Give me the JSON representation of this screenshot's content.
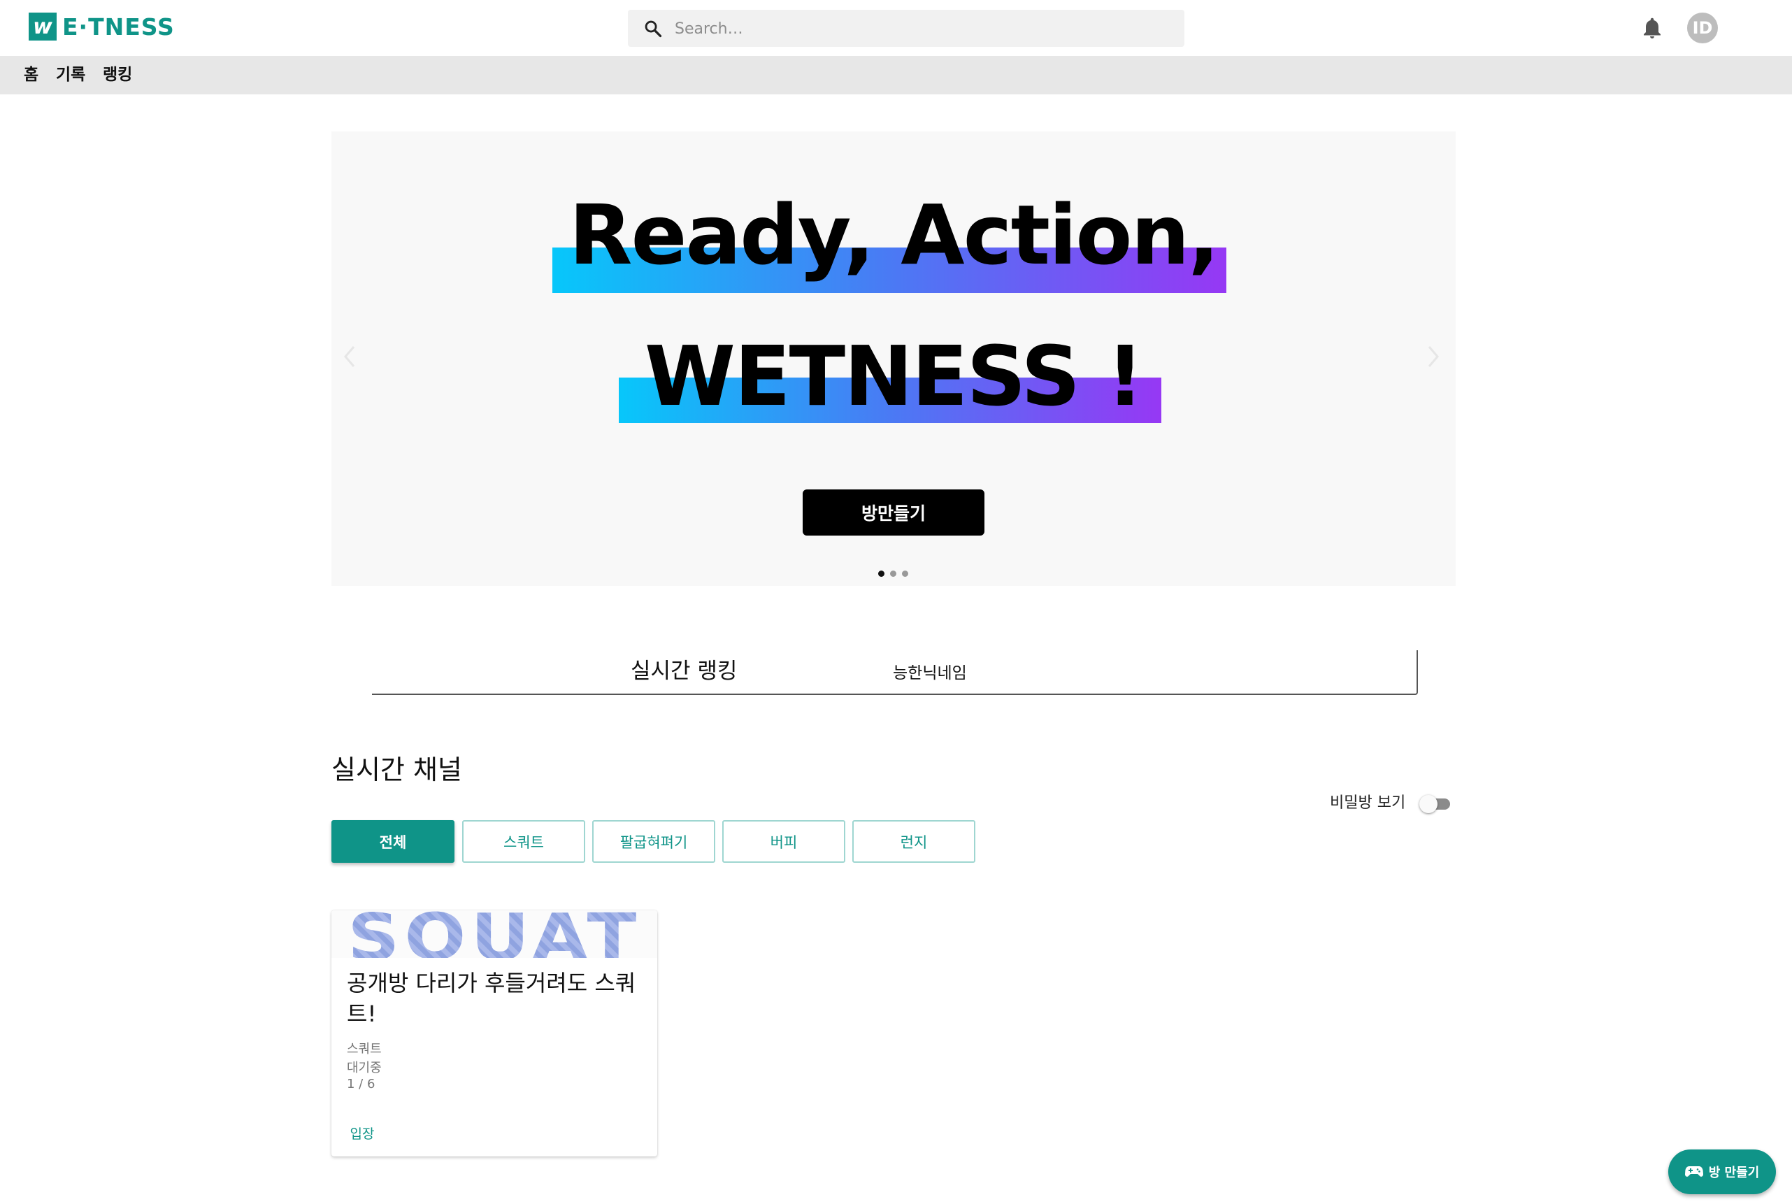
{
  "header": {
    "logo_mark": "w",
    "logo_text": "E·TNESS",
    "search_placeholder": "Search…",
    "avatar_initials": "ID"
  },
  "nav": {
    "items": [
      {
        "label": "홈"
      },
      {
        "label": "기록"
      },
      {
        "label": "랭킹"
      }
    ]
  },
  "banner": {
    "headline_line1": "Ready, Action,",
    "headline_line2": "WETNESS !",
    "button_label": "방만들기",
    "slide_count": 3,
    "active_slide": 1
  },
  "ranking": {
    "title": "실시간 랭킹",
    "current_name": "능한닉네임"
  },
  "channels": {
    "title": "실시간 채널",
    "secret_toggle_label": "비밀방 보기",
    "secret_toggle_on": false,
    "filters": [
      {
        "label": "전체",
        "active": true
      },
      {
        "label": "스쿼트",
        "active": false
      },
      {
        "label": "팔굽혀펴기",
        "active": false
      },
      {
        "label": "버피",
        "active": false
      },
      {
        "label": "런지",
        "active": false
      }
    ],
    "rooms": [
      {
        "image_text": "SQUAT",
        "title": "공개방 다리가 후들거려도 스쿼트!",
        "category": "스쿼트",
        "status": "대기중",
        "occupancy": "1 / 6",
        "enter_label": "입장"
      }
    ]
  },
  "fab": {
    "label": "방 만들기"
  },
  "colors": {
    "brand": "#0f9488",
    "nav_bg": "#e7e7e7",
    "banner_gradient": [
      "#07c7fa",
      "#4a7af4",
      "#9638f4"
    ]
  }
}
